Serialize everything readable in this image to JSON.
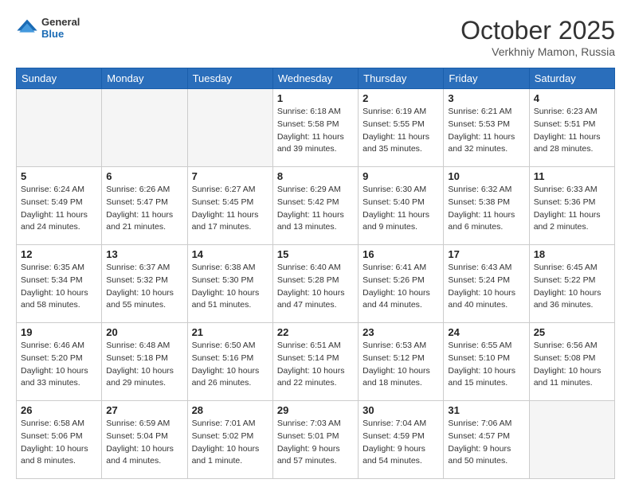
{
  "header": {
    "logo": {
      "general": "General",
      "blue": "Blue"
    },
    "title": "October 2025",
    "location": "Verkhniy Mamon, Russia"
  },
  "weekdays": [
    "Sunday",
    "Monday",
    "Tuesday",
    "Wednesday",
    "Thursday",
    "Friday",
    "Saturday"
  ],
  "weeks": [
    [
      {
        "day": "",
        "empty": true
      },
      {
        "day": "",
        "empty": true
      },
      {
        "day": "",
        "empty": true
      },
      {
        "day": "1",
        "sunrise": "6:18 AM",
        "sunset": "5:58 PM",
        "daylight": "11 hours and 39 minutes."
      },
      {
        "day": "2",
        "sunrise": "6:19 AM",
        "sunset": "5:55 PM",
        "daylight": "11 hours and 35 minutes."
      },
      {
        "day": "3",
        "sunrise": "6:21 AM",
        "sunset": "5:53 PM",
        "daylight": "11 hours and 32 minutes."
      },
      {
        "day": "4",
        "sunrise": "6:23 AM",
        "sunset": "5:51 PM",
        "daylight": "11 hours and 28 minutes."
      }
    ],
    [
      {
        "day": "5",
        "sunrise": "6:24 AM",
        "sunset": "5:49 PM",
        "daylight": "11 hours and 24 minutes."
      },
      {
        "day": "6",
        "sunrise": "6:26 AM",
        "sunset": "5:47 PM",
        "daylight": "11 hours and 21 minutes."
      },
      {
        "day": "7",
        "sunrise": "6:27 AM",
        "sunset": "5:45 PM",
        "daylight": "11 hours and 17 minutes."
      },
      {
        "day": "8",
        "sunrise": "6:29 AM",
        "sunset": "5:42 PM",
        "daylight": "11 hours and 13 minutes."
      },
      {
        "day": "9",
        "sunrise": "6:30 AM",
        "sunset": "5:40 PM",
        "daylight": "11 hours and 9 minutes."
      },
      {
        "day": "10",
        "sunrise": "6:32 AM",
        "sunset": "5:38 PM",
        "daylight": "11 hours and 6 minutes."
      },
      {
        "day": "11",
        "sunrise": "6:33 AM",
        "sunset": "5:36 PM",
        "daylight": "11 hours and 2 minutes."
      }
    ],
    [
      {
        "day": "12",
        "sunrise": "6:35 AM",
        "sunset": "5:34 PM",
        "daylight": "10 hours and 58 minutes."
      },
      {
        "day": "13",
        "sunrise": "6:37 AM",
        "sunset": "5:32 PM",
        "daylight": "10 hours and 55 minutes."
      },
      {
        "day": "14",
        "sunrise": "6:38 AM",
        "sunset": "5:30 PM",
        "daylight": "10 hours and 51 minutes."
      },
      {
        "day": "15",
        "sunrise": "6:40 AM",
        "sunset": "5:28 PM",
        "daylight": "10 hours and 47 minutes."
      },
      {
        "day": "16",
        "sunrise": "6:41 AM",
        "sunset": "5:26 PM",
        "daylight": "10 hours and 44 minutes."
      },
      {
        "day": "17",
        "sunrise": "6:43 AM",
        "sunset": "5:24 PM",
        "daylight": "10 hours and 40 minutes."
      },
      {
        "day": "18",
        "sunrise": "6:45 AM",
        "sunset": "5:22 PM",
        "daylight": "10 hours and 36 minutes."
      }
    ],
    [
      {
        "day": "19",
        "sunrise": "6:46 AM",
        "sunset": "5:20 PM",
        "daylight": "10 hours and 33 minutes."
      },
      {
        "day": "20",
        "sunrise": "6:48 AM",
        "sunset": "5:18 PM",
        "daylight": "10 hours and 29 minutes."
      },
      {
        "day": "21",
        "sunrise": "6:50 AM",
        "sunset": "5:16 PM",
        "daylight": "10 hours and 26 minutes."
      },
      {
        "day": "22",
        "sunrise": "6:51 AM",
        "sunset": "5:14 PM",
        "daylight": "10 hours and 22 minutes."
      },
      {
        "day": "23",
        "sunrise": "6:53 AM",
        "sunset": "5:12 PM",
        "daylight": "10 hours and 18 minutes."
      },
      {
        "day": "24",
        "sunrise": "6:55 AM",
        "sunset": "5:10 PM",
        "daylight": "10 hours and 15 minutes."
      },
      {
        "day": "25",
        "sunrise": "6:56 AM",
        "sunset": "5:08 PM",
        "daylight": "10 hours and 11 minutes."
      }
    ],
    [
      {
        "day": "26",
        "sunrise": "6:58 AM",
        "sunset": "5:06 PM",
        "daylight": "10 hours and 8 minutes."
      },
      {
        "day": "27",
        "sunrise": "6:59 AM",
        "sunset": "5:04 PM",
        "daylight": "10 hours and 4 minutes."
      },
      {
        "day": "28",
        "sunrise": "7:01 AM",
        "sunset": "5:02 PM",
        "daylight": "10 hours and 1 minute."
      },
      {
        "day": "29",
        "sunrise": "7:03 AM",
        "sunset": "5:01 PM",
        "daylight": "9 hours and 57 minutes."
      },
      {
        "day": "30",
        "sunrise": "7:04 AM",
        "sunset": "4:59 PM",
        "daylight": "9 hours and 54 minutes."
      },
      {
        "day": "31",
        "sunrise": "7:06 AM",
        "sunset": "4:57 PM",
        "daylight": "9 hours and 50 minutes."
      },
      {
        "day": "",
        "empty": true
      }
    ]
  ]
}
